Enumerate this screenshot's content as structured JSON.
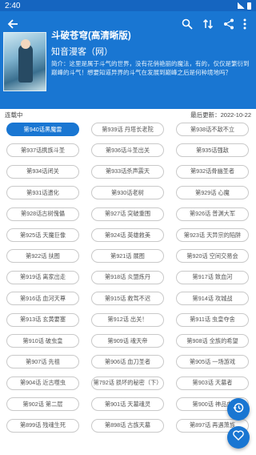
{
  "status_bar": {
    "time": "2:40"
  },
  "toolbar": {
    "back_icon": "arrow-back-icon",
    "search_icon": "search-icon",
    "sort_icon": "sort-icon",
    "share_icon": "share-icon",
    "more_icon": "more-vert-icon"
  },
  "book": {
    "title": "斗破苍穹(高清晰版)",
    "author": "知音漫客（网）",
    "intro": "简介：这里是属于斗气的世界，没有花俏艳丽的魔法，有的，仅仅是繁衍到巅峰的斗气！想要知道异界的斗气在发展到巅峰之后是何种境地吗？"
  },
  "info": {
    "status": "连载中",
    "updated": "最后更新：2022-10-22"
  },
  "chapters": [
    "第940话黑魔雷",
    "第939话 丹塔长老院",
    "第938话不敌不立",
    "第937话携族斗圣",
    "第936话斗圣出关",
    "第935话强敌",
    "第934话闭关",
    "第933话杀声震天",
    "第932话骨幽圣者",
    "第931话遗化",
    "第930话老树",
    "第929话 心魔",
    "第928话古树傀儡",
    "第927话 突破重围",
    "第926话 普渊大军",
    "第925话 天魔巨像",
    "第924话 英雄救美",
    "第923话 天异宗的陷阱",
    "第922话 扶图",
    "第921话 展图",
    "第920话 空间交易会",
    "第919话 离家出走",
    "第918话 炎盟炼丹",
    "第917话 致血河",
    "第916话 血河天尊",
    "第915话 救驾不迟",
    "第914话 攻城战",
    "第913话 玄黄要塞",
    "第912话 出关！",
    "第911话 虫皇夺舍",
    "第910话 破虫皇",
    "第909话 魂天帝",
    "第908话 全族的希望",
    "第907话 先祖",
    "第906话 血刀圣者",
    "第905话 一场游戏",
    "第904话 近古噬虫",
    "第792话 损坏的秘密（下）",
    "第903话 天墓者",
    "第902话 第二层",
    "第901话 天墓魂灵",
    "第900话 神品血",
    "第899话 残魂生死",
    "第898话 古族天墓",
    "第897话 再遇萧族"
  ],
  "active_chapter_index": 0,
  "fabs": {
    "history_icon": "history-icon",
    "favorite_icon": "favorite-icon"
  }
}
